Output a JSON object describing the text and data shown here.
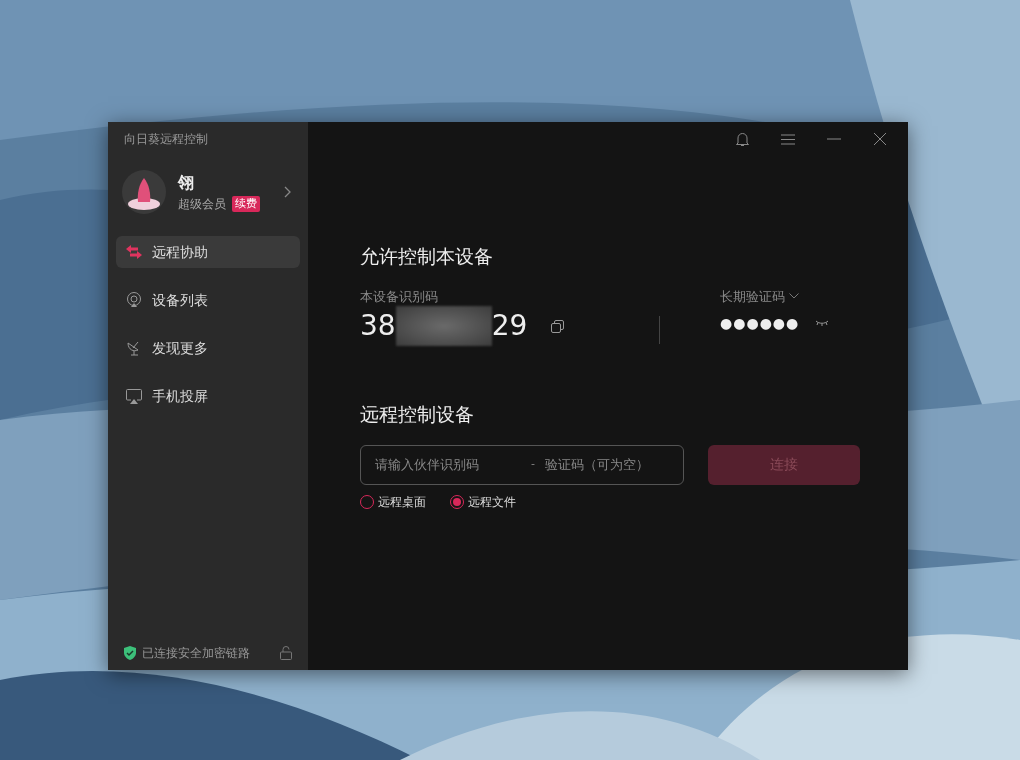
{
  "app": {
    "title": "向日葵远程控制"
  },
  "user": {
    "name": "翎",
    "membership": "超级会员",
    "badge": "续费"
  },
  "nav": [
    {
      "label": "远程协助",
      "selected": true
    },
    {
      "label": "设备列表",
      "selected": false
    },
    {
      "label": "发现更多",
      "selected": false
    },
    {
      "label": "手机投屏",
      "selected": false
    }
  ],
  "footer": {
    "status": "已连接安全加密链路"
  },
  "allow": {
    "heading": "允许控制本设备",
    "id_label": "本设备识别码",
    "id_start": "38",
    "id_end": "29",
    "code_label": "长期验证码",
    "code": "●●●●●●"
  },
  "remote": {
    "heading": "远程控制设备",
    "partner_placeholder": "请输入伙伴识别码",
    "separator": "-",
    "code_placeholder": "验证码（可为空）",
    "connect": "连接",
    "connect_disabled": true,
    "modes": [
      {
        "label": "远程桌面",
        "selected": false
      },
      {
        "label": "远程文件",
        "selected": true
      }
    ]
  }
}
